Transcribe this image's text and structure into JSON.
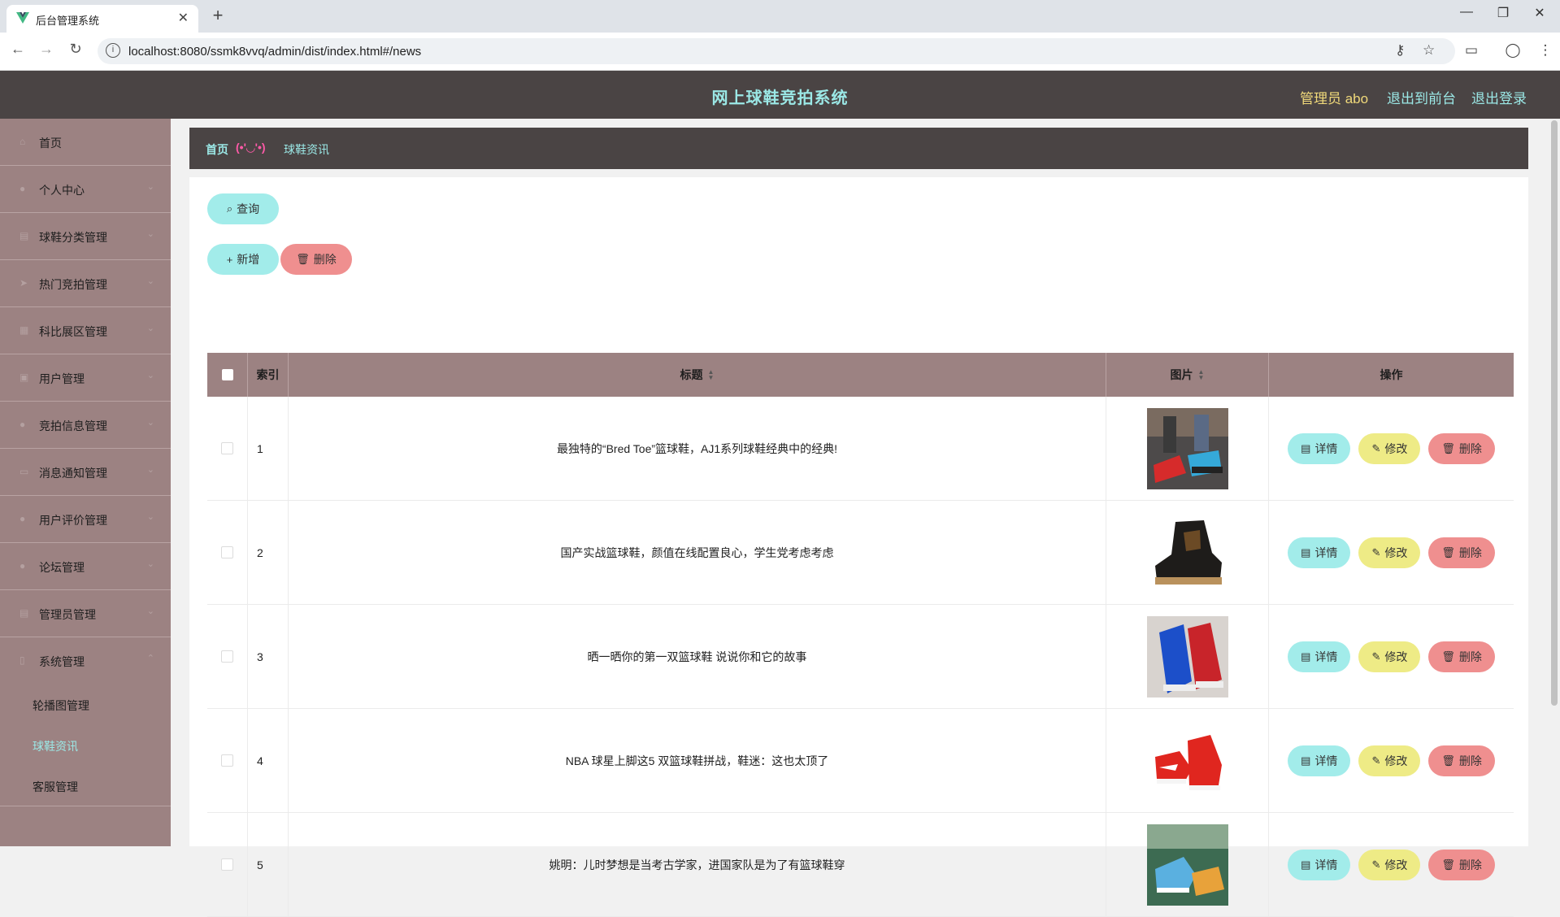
{
  "browser": {
    "tab_title": "后台管理系统",
    "url": "localhost:8080/ssmk8vvq/admin/dist/index.html#/news"
  },
  "header": {
    "system_title": "网上球鞋竞拍系统",
    "admin_label": "管理员 abo",
    "back_to_front": "退出到前台",
    "logout": "退出登录"
  },
  "sidebar": {
    "items": [
      {
        "label": "首页",
        "icon": "home-icon"
      },
      {
        "label": "个人中心",
        "icon": "user-icon"
      },
      {
        "label": "球鞋分类管理",
        "icon": "list-icon"
      },
      {
        "label": "热门竞拍管理",
        "icon": "send-icon"
      },
      {
        "label": "科比展区管理",
        "icon": "grid-icon"
      },
      {
        "label": "用户管理",
        "icon": "people-icon"
      },
      {
        "label": "竞拍信息管理",
        "icon": "location-icon"
      },
      {
        "label": "消息通知管理",
        "icon": "message-icon"
      },
      {
        "label": "用户评价管理",
        "icon": "user-icon"
      },
      {
        "label": "论坛管理",
        "icon": "user-icon"
      },
      {
        "label": "管理员管理",
        "icon": "table-icon"
      },
      {
        "label": "系统管理",
        "icon": "mobile-icon"
      }
    ],
    "sub_items": [
      {
        "label": "轮播图管理"
      },
      {
        "label": "球鞋资讯"
      },
      {
        "label": "客服管理"
      }
    ]
  },
  "breadcrumb": {
    "home": "首页",
    "separator": "(•'◡'•)",
    "current": "球鞋资讯"
  },
  "toolbar": {
    "query_label": "查询",
    "add_label": "新增",
    "delete_label": "删除"
  },
  "table": {
    "headers": {
      "index": "索引",
      "title": "标题",
      "image": "图片",
      "actions": "操作"
    },
    "action_labels": {
      "detail": "详情",
      "edit": "修改",
      "delete": "删除"
    },
    "rows": [
      {
        "index": "1",
        "title": "最独特的“Bred Toe”篮球鞋，AJ1系列球鞋经典中的经典!"
      },
      {
        "index": "2",
        "title": "国产实战篮球鞋，颜值在线配置良心，学生党考虑考虑"
      },
      {
        "index": "3",
        "title": "晒一晒你的第一双篮球鞋 说说你和它的故事"
      },
      {
        "index": "4",
        "title": "NBA 球星上脚这5 双篮球鞋拼战，鞋迷：这也太顶了"
      },
      {
        "index": "5",
        "title": "姚明：儿时梦想是当考古学家，进国家队是为了有篮球鞋穿"
      }
    ]
  },
  "colors": {
    "header_bg": "#4a4444",
    "sidebar_bg": "#9c8282",
    "accent_cyan": "#9be8e6",
    "button_cyan": "#a2ecea",
    "button_red": "#ef8f8f",
    "button_yellow": "#eeeb86"
  }
}
